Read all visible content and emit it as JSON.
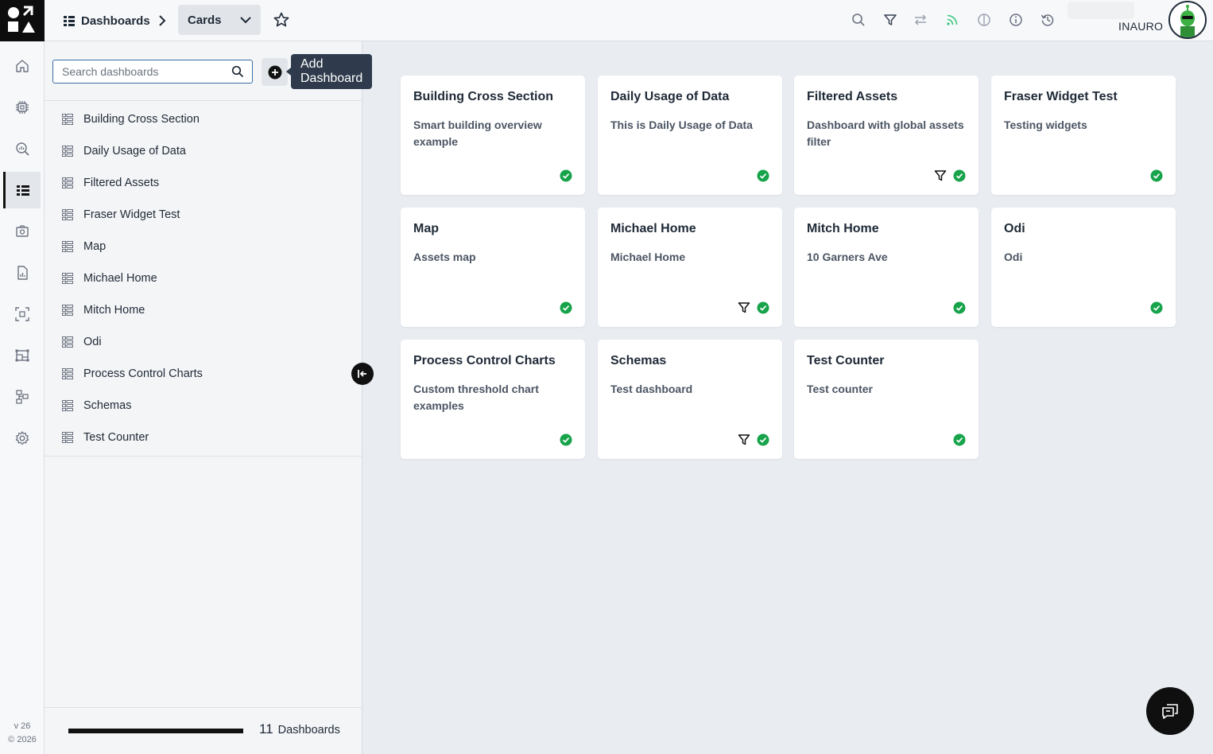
{
  "header": {
    "breadcrumb_label": "Dashboards",
    "view_mode": "Cards",
    "org_name": "INAURO"
  },
  "icons": {
    "toolbar": [
      "search-icon",
      "filter-icon",
      "swap-icon",
      "feed-icon",
      "contrast-icon",
      "info-icon",
      "history-icon"
    ],
    "feed_color": "#34c77b"
  },
  "nav": {
    "items": [
      "home-icon",
      "cpu-icon",
      "search-insights-icon",
      "dashboards-icon",
      "camera-icon",
      "report-icon",
      "scan-icon",
      "floorplan-icon",
      "hierarchy-icon",
      "settings-icon"
    ],
    "active_index": 3,
    "version": "v 26",
    "copyright": "© 2026"
  },
  "sidebar": {
    "search_placeholder": "Search dashboards",
    "add_tooltip": "Add Dashboard",
    "items": [
      "Building Cross Section",
      "Daily Usage of Data",
      "Filtered Assets",
      "Fraser Widget Test",
      "Map",
      "Michael Home",
      "Mitch Home",
      "Odi",
      "Process Control Charts",
      "Schemas",
      "Test Counter"
    ],
    "count": "11",
    "count_label": "Dashboards"
  },
  "cards": [
    {
      "title": "Building Cross Section",
      "desc": "Smart building overview example",
      "filter": false
    },
    {
      "title": "Daily Usage of Data",
      "desc": "This is Daily Usage of Data",
      "filter": false
    },
    {
      "title": "Filtered Assets",
      "desc": "Dashboard with global assets filter",
      "filter": true
    },
    {
      "title": "Fraser Widget Test",
      "desc": "Testing widgets",
      "filter": false
    },
    {
      "title": "Map",
      "desc": "Assets map",
      "filter": false
    },
    {
      "title": "Michael Home",
      "desc": "Michael Home",
      "filter": true
    },
    {
      "title": "Mitch Home",
      "desc": "10 Garners Ave",
      "filter": false
    },
    {
      "title": "Odi",
      "desc": "Odi",
      "filter": false
    },
    {
      "title": "Process Control Charts",
      "desc": "Custom threshold chart examples",
      "filter": false
    },
    {
      "title": "Schemas",
      "desc": "Test dashboard",
      "filter": true
    },
    {
      "title": "Test Counter",
      "desc": "Test counter",
      "filter": false
    }
  ],
  "colors": {
    "ok_green": "#16a34a",
    "tooltip_bg": "#2f3b4d",
    "accent_dark": "#111111"
  }
}
